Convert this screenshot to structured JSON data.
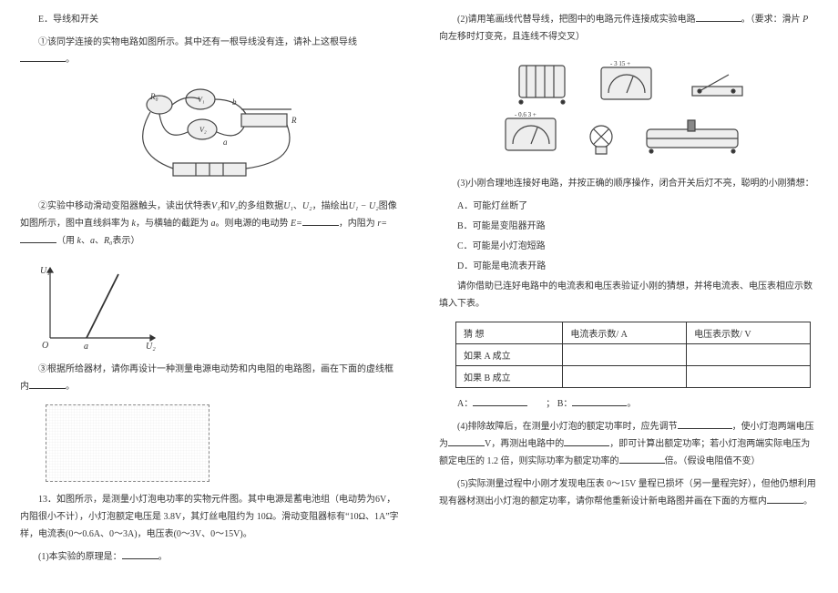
{
  "left": {
    "e": "E．导线和开关",
    "step1": "①该同学连接的实物电路如图所示。其中还有一根导线没有连，请补上这根导线",
    "step2a": "②实验中移动滑动变阻器触头，读出伏特表",
    "step2b": "和",
    "step2c": "的多组数据",
    "step2d": "、",
    "step2e": "，描绘出",
    "step2f": "图像如图所示，图中直线斜率为",
    "step2g": "，与横轴的截距为",
    "step2h": "。则电源的电动势",
    "step2i": "，内阻为",
    "step2j": "（用",
    "step2k": "、",
    "step2l": "、",
    "step2m": "表示）",
    "v1": "V₁",
    "v2": "V₂",
    "u1": "U₁",
    "u2": "U₂",
    "u1u2": "U₁ − U₂",
    "k": "k",
    "a": "a",
    "r0": "R₀",
    "eeq": "E=",
    "req": "r=",
    "step3": "③根据所给器材，请你再设计一种测量电源电动势和内电阻的电路图，画在下面的虚线框内",
    "q13a": "13．如图所示，是测量小灯泡电功率的实物元件图。其中电源是蓄电池组（电动势为6V，内阻很小不计），小灯泡额定电压是 3.8V，其灯丝电阻约为 10Ω。滑动变阻器标有“10Ω、1A”字样，电流表(0～0.6A、0～3A)，电压表(0～3V、0～15V)。",
    "q13_1": "(1)本实验的原理是：",
    "graph_u1": "U₁",
    "graph_u2": "U₂",
    "graph_a": "a",
    "graph_o": "O"
  },
  "right": {
    "q2a": "(2)请用笔画线代替导线，把图中的电路元件连接成实验电路",
    "q2b": "。（要求：滑片",
    "q2c": "向左移时灯变亮，且连线不得交叉）",
    "p": "P",
    "q3": "(3)小刚合理地连接好电路，并按正确的顺序操作，闭合开关后灯不亮，聪明的小刚猜想：",
    "optA": "A．可能灯丝断了",
    "optB": "B．可能是变阻器开路",
    "optC": "C．可能是小灯泡短路",
    "optD": "D．可能是电流表开路",
    "q3t": "请你借助已连好电路中的电流表和电压表验证小刚的猜想，并将电流表、电压表相应示数填入下表。",
    "th1": "猜   想",
    "th2": "电流表示数/ A",
    "th3": "电压表示数/ V",
    "rowA": "如果 A 成立",
    "rowB": "如果 B 成立",
    "alab": "A：",
    "blab": "；  B：",
    "q4a": "(4)排除故障后，在测量小灯泡的额定功率时，应先调节",
    "q4b": "，使小灯泡两端电压为",
    "q4c": "V，再测出电路中的",
    "q4d": "，即可计算出额定功率；若小灯泡两端实际电压为额定电压的 1.2 倍，则实际功率为额定功率的",
    "q4e": "倍。（假设电阻值不变）",
    "q5": "(5)实际测量过程中小刚才发现电压表 0～15V 量程已损坏（另一量程完好），但他仍想利用现有器材测出小灯泡的额定功率，请你帮他重新设计新电路图并画在下面的方框内",
    "period": "。"
  }
}
